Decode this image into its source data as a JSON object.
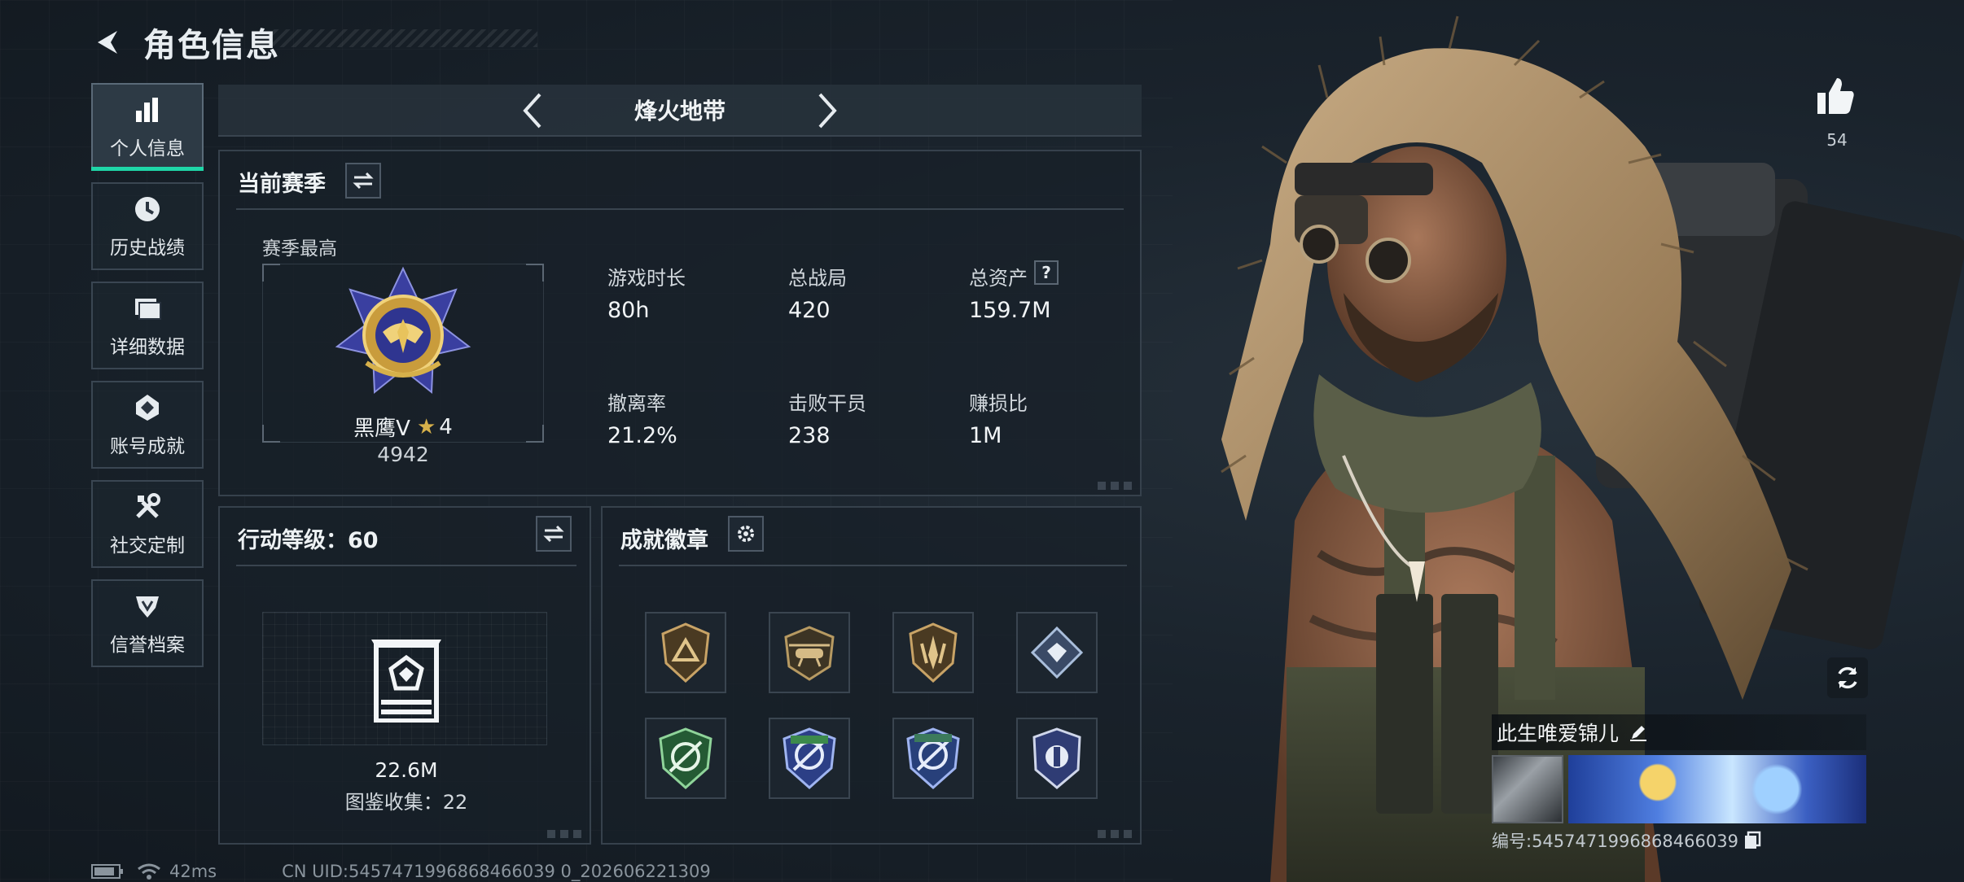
{
  "header": {
    "title": "角色信息"
  },
  "sidebar": {
    "items": [
      {
        "label": "个人信息",
        "icon": "bar-chart-icon",
        "active": true
      },
      {
        "label": "历史战绩",
        "icon": "history-clock-icon",
        "active": false
      },
      {
        "label": "详细数据",
        "icon": "folder-icon",
        "active": false
      },
      {
        "label": "账号成就",
        "icon": "achievement-icon",
        "active": false
      },
      {
        "label": "社交定制",
        "icon": "tools-icon",
        "active": false
      },
      {
        "label": "信誉档案",
        "icon": "reputation-icon",
        "active": false
      }
    ]
  },
  "map": {
    "name": "烽火地带"
  },
  "season": {
    "title": "当前赛季",
    "best_label": "赛季最高",
    "rank_name": "黑鹰V",
    "rank_stars": "4",
    "rank_score": "4942",
    "stats": [
      {
        "label": "游戏时长",
        "value": "80h"
      },
      {
        "label": "总战局",
        "value": "420"
      },
      {
        "label": "总资产",
        "value": "159.7M",
        "help": "?"
      },
      {
        "label": "撤离率",
        "value": "21.2%"
      },
      {
        "label": "击败干员",
        "value": "238"
      },
      {
        "label": "赚损比",
        "value": "1M"
      }
    ]
  },
  "level": {
    "title": "行动等级：60",
    "value": "22.6M",
    "collection": "图鉴收集：22"
  },
  "badges": {
    "title": "成就徽章",
    "items": [
      "triangle-badge-icon",
      "helicopter-badge-icon",
      "blade-badge-icon",
      "diamond-badge-icon",
      "green-target-badge-icon",
      "blue-target-badge-icon",
      "teal-target-badge-icon",
      "silver-shield-badge-icon"
    ]
  },
  "likes": {
    "count": "54"
  },
  "player": {
    "name": "此生唯爱锦儿",
    "id": "编号:5457471996868466039"
  },
  "status": {
    "ping": "42ms",
    "uid": "CN UID:5457471996868466039 0_202606221309"
  },
  "colors": {
    "accent": "#1fd6a8",
    "background": "#141c24",
    "gold": "#d6b04a"
  }
}
